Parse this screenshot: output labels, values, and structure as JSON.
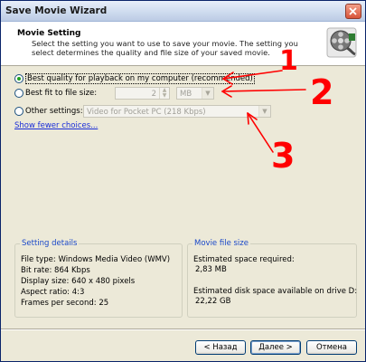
{
  "window": {
    "title": "Save Movie Wizard"
  },
  "header": {
    "title": "Movie Setting",
    "description": "Select the setting you want to use to save your movie. The setting you select determines the quality and file size of your saved movie."
  },
  "options": {
    "best_quality_label": "Best quality for playback on my computer (recommended)",
    "best_fit_label": "Best fit to file size:",
    "file_size_value": "2",
    "file_size_unit": "MB",
    "other_settings_label": "Other settings:",
    "other_settings_value": "Video for Pocket PC (218 Kbps)",
    "selected": "best_quality"
  },
  "fewer_choices_link": "Show fewer choices...",
  "setting_details": {
    "title": "Setting details",
    "lines": [
      "File type: Windows Media Video (WMV)",
      "Bit rate: 864 Kbps",
      "Display size: 640 x 480 pixels",
      "Aspect ratio: 4:3",
      "Frames per second: 25"
    ]
  },
  "movie_file_size": {
    "title": "Movie file size",
    "space_required_label": "Estimated space required:",
    "space_required_value": "2,83 MB",
    "disk_space_label": "Estimated disk space available on drive D:",
    "disk_space_value": "22,22 GB"
  },
  "buttons": {
    "back": "< Назад",
    "next": "Далее >",
    "cancel": "Отмена"
  },
  "annotations": [
    "1",
    "2",
    "3"
  ],
  "colors": {
    "annotation": "#ff0000",
    "link": "#1a2dd8",
    "group_label": "#1a48c9"
  }
}
